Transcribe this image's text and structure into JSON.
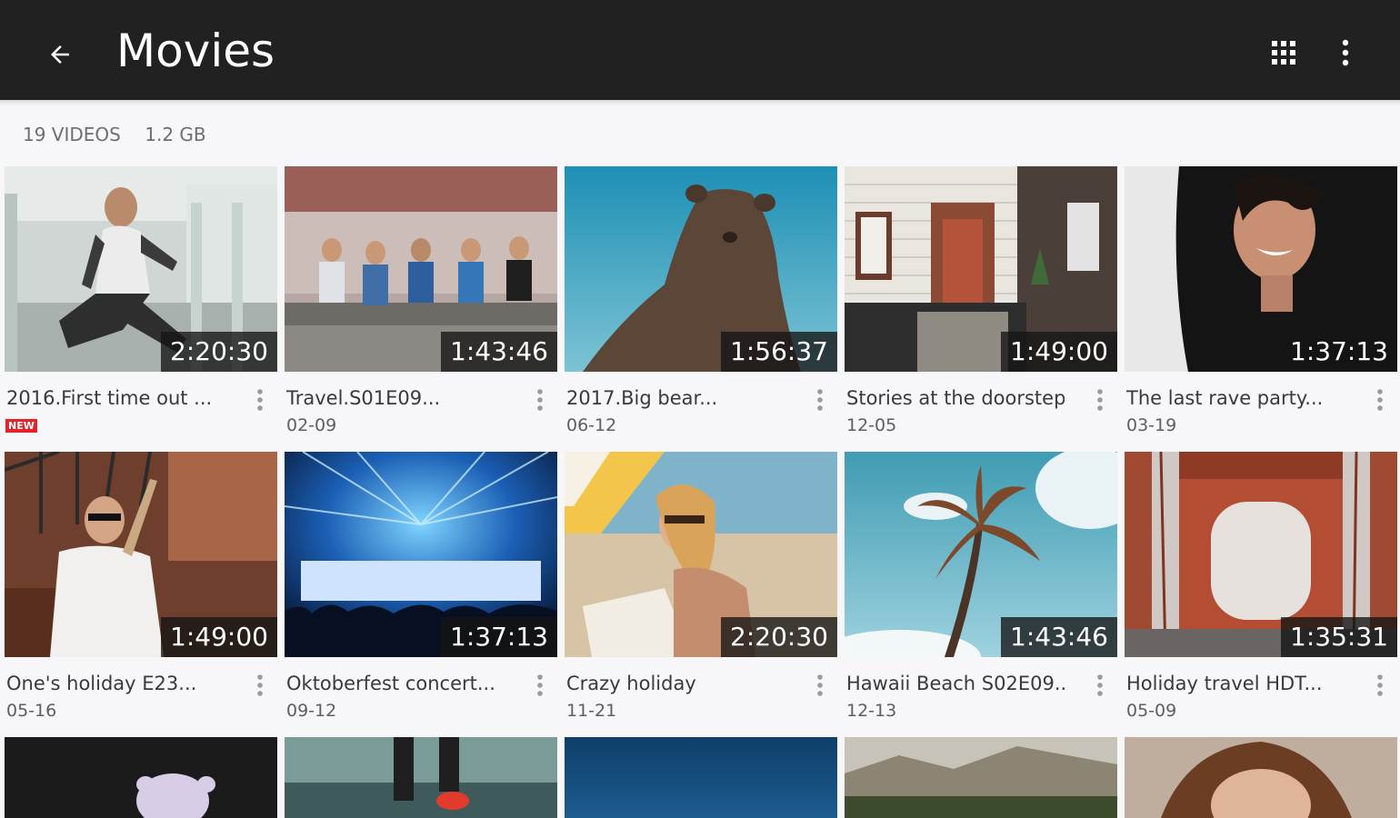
{
  "header": {
    "title": "Movies",
    "back_icon": "arrow-back-icon",
    "grid_icon": "grid-view-icon",
    "more_icon": "more-vert-icon"
  },
  "summary": {
    "video_count": "19 VIDEOS",
    "total_size": "1.2 GB"
  },
  "videos": [
    {
      "title": "2016.First time out ...",
      "date": "",
      "badge": "NEW",
      "duration": "2:20:30"
    },
    {
      "title": "Travel.S01E09...",
      "date": "02-09",
      "duration": "1:43:46"
    },
    {
      "title": "2017.Big bear...",
      "date": "06-12",
      "duration": "1:56:37"
    },
    {
      "title": "Stories at the doorstep...",
      "date": "12-05",
      "duration": "1:49:00"
    },
    {
      "title": "The last rave party...",
      "date": "03-19",
      "duration": "1:37:13"
    },
    {
      "title": "One's holiday E23...",
      "date": "05-16",
      "duration": "1:49:00"
    },
    {
      "title": "Oktoberfest concert...",
      "date": "09-12",
      "duration": "1:37:13"
    },
    {
      "title": "Crazy holiday",
      "date": "11-21",
      "duration": "2:20:30"
    },
    {
      "title": "Hawaii Beach S02E09...",
      "date": "12-13",
      "duration": "1:43:46"
    },
    {
      "title": "Holiday travel HDT...",
      "date": "05-09",
      "duration": "1:35:31"
    }
  ],
  "colors": {
    "topbar": "#212121",
    "background": "#f7f6f9",
    "badge_new": "#e3232b"
  }
}
